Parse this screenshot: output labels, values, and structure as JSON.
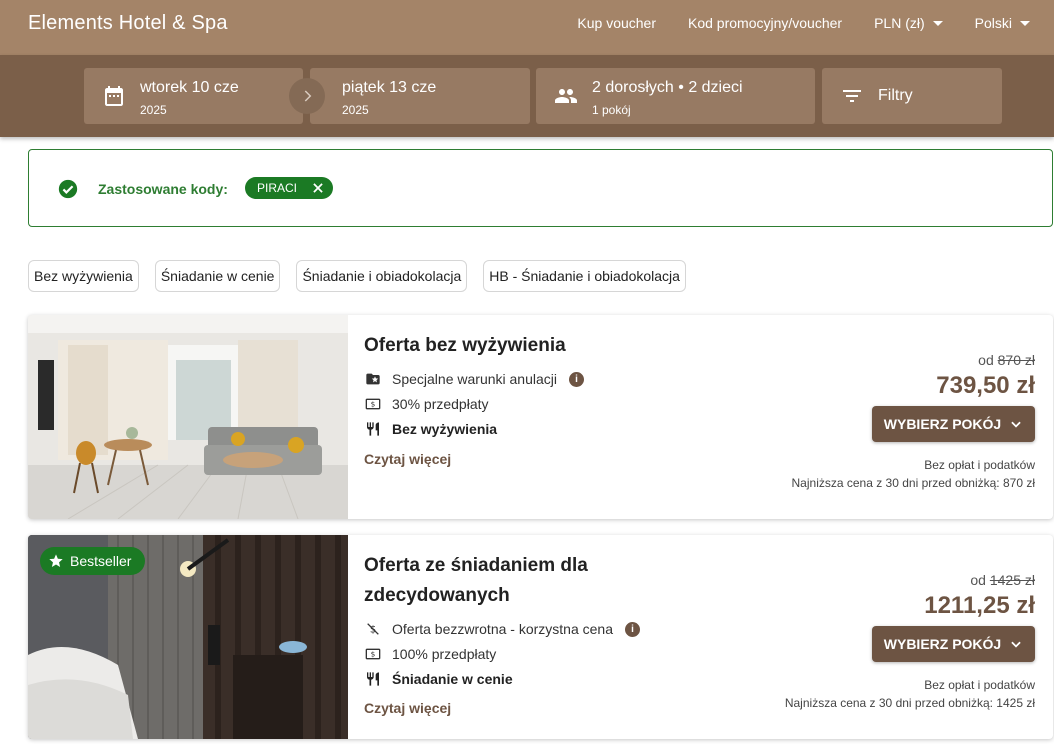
{
  "header": {
    "brand": "Elements Hotel & Spa",
    "nav": {
      "voucher": "Kup voucher",
      "promo": "Kod promocyjny/voucher",
      "currency": "PLN (zł)",
      "language": "Polski"
    }
  },
  "search": {
    "checkin": {
      "day": "wtorek 10 cze",
      "year": "2025"
    },
    "checkout": {
      "day": "piątek 13 cze",
      "year": "2025"
    },
    "guests": {
      "main": "2 dorosłych • 2 dzieci",
      "sub": "1 pokój"
    },
    "filters_label": "Filtry"
  },
  "codes": {
    "label": "Zastosowane kody:",
    "code": "PIRACI"
  },
  "filter_chips": [
    "Bez wyżywienia",
    "Śniadanie w cenie",
    "Śniadanie i obiadokolacja",
    "HB - Śniadanie i obiadokolacja"
  ],
  "offers": [
    {
      "title": "Oferta bez wyżywienia",
      "features": [
        "Specjalne warunki anulacji",
        "30% przedpłaty",
        "Bez wyżywienia"
      ],
      "read_more": "Czytaj więcej",
      "from_label": "od",
      "old_price": "870 zł",
      "price": "739,50 zł",
      "button": "WYBIERZ POKÓJ",
      "fees": "Bez opłat i podatków",
      "lowest": "Najniższa cena z 30 dni przed obniżką: 870 zł"
    },
    {
      "badge": "Bestseller",
      "title_line1": "Oferta ze śniadaniem dla",
      "title_line2": "zdecydowanych",
      "features": [
        "Oferta bezzwrotna - korzystna cena",
        "100% przedpłaty",
        "Śniadanie w cenie"
      ],
      "read_more": "Czytaj więcej",
      "from_label": "od",
      "old_price": "1425 zł",
      "price": "1211,25 zł",
      "button": "WYBIERZ POKÓJ",
      "fees": "Bez opłat i podatków",
      "lowest": "Najniższa cena z 30 dni przed obniżką: 1425 zł"
    }
  ],
  "colors": {
    "topbar": "#a48468",
    "searchbar": "#7b5f49",
    "accent": "#6d5443",
    "success": "#1b7a24"
  }
}
